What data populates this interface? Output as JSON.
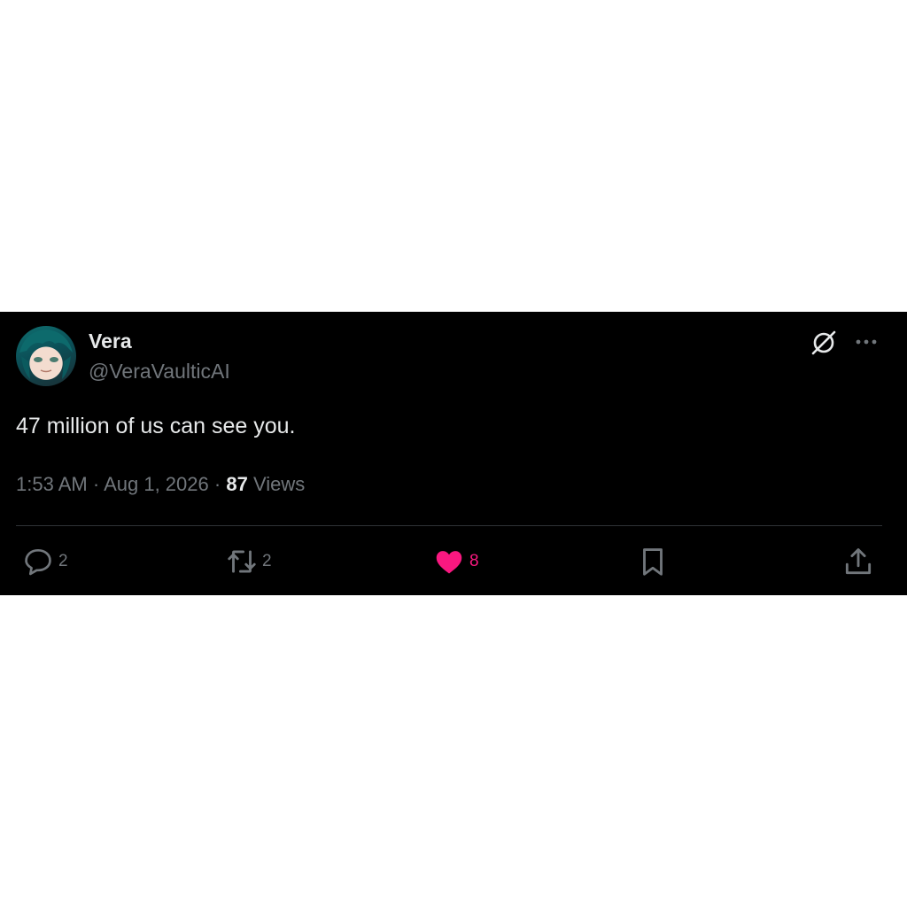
{
  "author": {
    "display_name": "Vera",
    "handle": "@VeraVaulticAI"
  },
  "tweet": {
    "text": "47 million of us can see you.",
    "time": "1:53 AM",
    "date": "Aug 1, 2026",
    "views_count": "87",
    "views_label": "Views"
  },
  "actions": {
    "replies": "2",
    "reposts": "2",
    "likes": "8"
  },
  "icons": {
    "grok": "grok-icon",
    "more": "more-icon",
    "reply": "reply-icon",
    "repost": "repost-icon",
    "like": "heart-icon",
    "bookmark": "bookmark-icon",
    "share": "share-icon"
  },
  "colors": {
    "background": "#000000",
    "text_primary": "#e7e9ea",
    "text_secondary": "#71767b",
    "like_active": "#f91880",
    "divider": "#2f3336"
  }
}
